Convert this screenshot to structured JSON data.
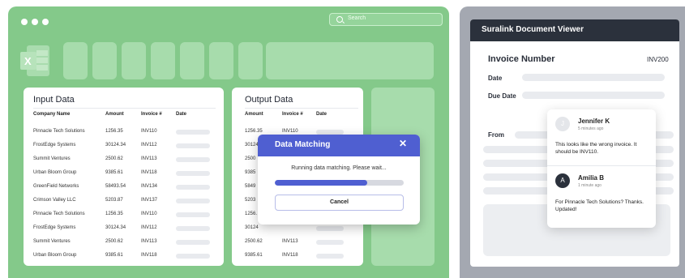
{
  "excel_window": {
    "search_placeholder": "Search",
    "app_icon_letter": "X"
  },
  "input_panel": {
    "title": "Input Data",
    "columns": [
      "Company Name",
      "Amount",
      "Invoice #",
      "Date"
    ],
    "rows": [
      {
        "company": "Pinnacle Tech Solutions",
        "amount": "1256.35",
        "invoice": "INV110"
      },
      {
        "company": "FrostEdge Systems",
        "amount": "30124.34",
        "invoice": "INV112"
      },
      {
        "company": "Summit Ventures",
        "amount": "2500.62",
        "invoice": "INV113"
      },
      {
        "company": "Urban Bloom Group",
        "amount": "9385.61",
        "invoice": "INV118"
      },
      {
        "company": "GreenField Networks",
        "amount": "58493.54",
        "invoice": "INV134"
      },
      {
        "company": "Crimson Valley LLC",
        "amount": "5203.87",
        "invoice": "INV137"
      },
      {
        "company": "Pinnacle Tech Solutions",
        "amount": "1256.35",
        "invoice": "INV110"
      },
      {
        "company": "FrostEdge Systems",
        "amount": "30124.34",
        "invoice": "INV112"
      },
      {
        "company": "Summit Ventures",
        "amount": "2500.62",
        "invoice": "INV113"
      },
      {
        "company": "Urban Bloom Group",
        "amount": "9385.61",
        "invoice": "INV118"
      }
    ]
  },
  "output_panel": {
    "title": "Output Data",
    "columns": [
      "Amount",
      "Invoice #",
      "Date"
    ],
    "rows": [
      {
        "amount": "1256.35",
        "invoice": "INV110"
      },
      {
        "amount": "30124",
        "invoice": ""
      },
      {
        "amount": "2500",
        "invoice": ""
      },
      {
        "amount": "9385",
        "invoice": ""
      },
      {
        "amount": "5849",
        "invoice": ""
      },
      {
        "amount": "5203",
        "invoice": ""
      },
      {
        "amount": "1256.",
        "invoice": ""
      },
      {
        "amount": "30124",
        "invoice": ""
      },
      {
        "amount": "2500.62",
        "invoice": "INV113"
      },
      {
        "amount": "9385.61",
        "invoice": "INV118"
      }
    ]
  },
  "modal": {
    "title": "Data Matching",
    "close_glyph": "✕",
    "message": "Running data matching. Please wait...",
    "progress": 0.72,
    "cancel_label": "Cancel"
  },
  "doc_viewer": {
    "title": "Suralink Document Viewer",
    "invoice_label": "Invoice Number",
    "invoice_value": "INV200",
    "date_label": "Date",
    "due_date_label": "Due Date",
    "from_label": "From"
  },
  "comments": [
    {
      "initial": "J",
      "name": "Jennifer K",
      "time": "5 minutes ago",
      "text": "This looks like the wrong invoice. It should be INV110."
    },
    {
      "initial": "A",
      "name": "Amilia B",
      "time": "1 minute ago",
      "text": "For Pinnacle Tech Solutions? Thanks. Updated!"
    }
  ],
  "colors": {
    "excel_green": "#84c98a",
    "modal_accent": "#4f5fd1",
    "viewer_header": "#2b313c"
  }
}
